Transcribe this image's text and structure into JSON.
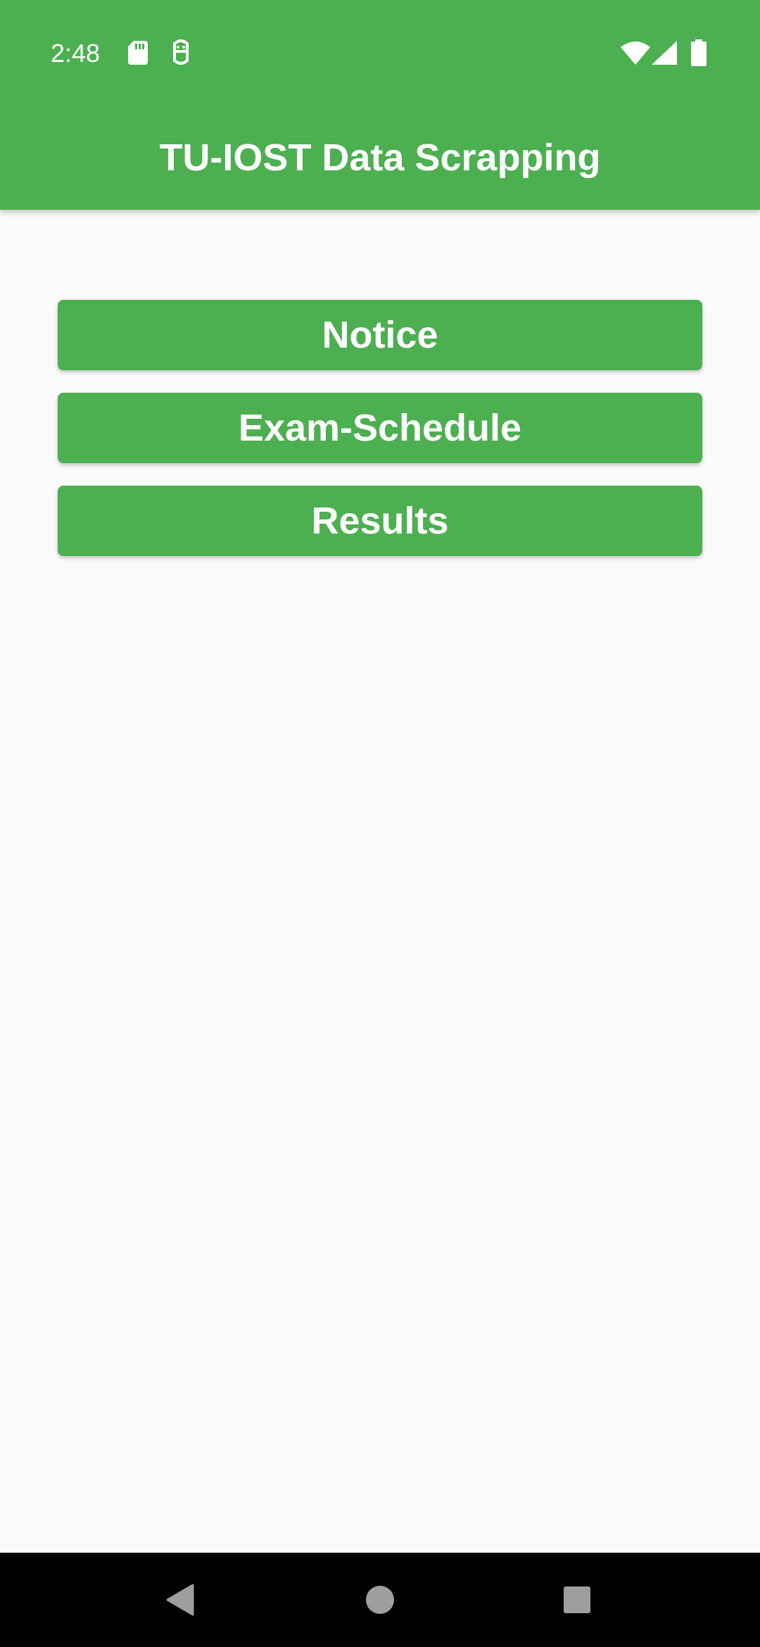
{
  "status_bar": {
    "time": "2:48",
    "icons": [
      "sd-card-icon",
      "sim-toolkit-icon",
      "wifi-icon",
      "cellular-signal-icon",
      "battery-icon"
    ]
  },
  "app_bar": {
    "title": "TU-IOST Data Scrapping",
    "color": "#4caf50"
  },
  "menu": {
    "buttons": [
      {
        "label": "Notice"
      },
      {
        "label": "Exam-Schedule"
      },
      {
        "label": "Results"
      }
    ],
    "button_color": "#4caf50",
    "text_color": "#ffffff"
  },
  "navigation_bar": {
    "buttons": [
      "back-icon",
      "home-icon",
      "recents-icon"
    ]
  }
}
